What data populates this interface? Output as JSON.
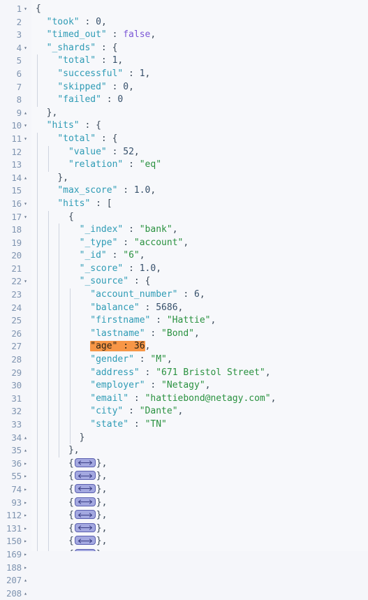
{
  "editor": {
    "name": "json-response-viewer",
    "language": "json",
    "colors": {
      "background": "#f7f8fb",
      "gutter_background": "#f5f6fa",
      "line_number": "#7f94b0",
      "key": "#2e9bb5",
      "string": "#29913f",
      "number": "#36506b",
      "boolean": "#7b57d6",
      "punctuation": "#3b4a5a",
      "search_highlight": "#f79646",
      "indent_guide": "#cfd4df",
      "fold_widget_fill": "#a3a8e0",
      "fold_widget_border": "#5a5fb0"
    },
    "search_highlight_text": "\"age\" : 36",
    "fold_icons": {
      "expanded": "chevron-down-icon",
      "collapsed": "chevron-right-icon",
      "end": "chevron-up-icon",
      "none": "no-fold-icon"
    },
    "collapsed_placeholder_icon": "horizontal-double-arrow-icon",
    "lines": [
      {
        "no": "1",
        "fold": "expanded",
        "guides": 0,
        "tokens": [
          {
            "t": "{",
            "c": "p"
          }
        ]
      },
      {
        "no": "2",
        "fold": "none",
        "guides": 0,
        "tokens": [
          {
            "t": "  ",
            "c": "p"
          },
          {
            "t": "\"took\"",
            "c": "k"
          },
          {
            "t": " : ",
            "c": "p"
          },
          {
            "t": "0",
            "c": "n"
          },
          {
            "t": ",",
            "c": "p"
          }
        ]
      },
      {
        "no": "3",
        "fold": "none",
        "guides": 0,
        "tokens": [
          {
            "t": "  ",
            "c": "p"
          },
          {
            "t": "\"timed_out\"",
            "c": "k"
          },
          {
            "t": " : ",
            "c": "p"
          },
          {
            "t": "false",
            "c": "b"
          },
          {
            "t": ",",
            "c": "p"
          }
        ]
      },
      {
        "no": "4",
        "fold": "expanded",
        "guides": 0,
        "tokens": [
          {
            "t": "  ",
            "c": "p"
          },
          {
            "t": "\"_shards\"",
            "c": "k"
          },
          {
            "t": " : ",
            "c": "p"
          },
          {
            "t": "{",
            "c": "p"
          }
        ]
      },
      {
        "no": "5",
        "fold": "none",
        "guides": 1,
        "tokens": [
          {
            "t": "    ",
            "c": "p"
          },
          {
            "t": "\"total\"",
            "c": "k"
          },
          {
            "t": " : ",
            "c": "p"
          },
          {
            "t": "1",
            "c": "n"
          },
          {
            "t": ",",
            "c": "p"
          }
        ]
      },
      {
        "no": "6",
        "fold": "none",
        "guides": 1,
        "tokens": [
          {
            "t": "    ",
            "c": "p"
          },
          {
            "t": "\"successful\"",
            "c": "k"
          },
          {
            "t": " : ",
            "c": "p"
          },
          {
            "t": "1",
            "c": "n"
          },
          {
            "t": ",",
            "c": "p"
          }
        ]
      },
      {
        "no": "7",
        "fold": "none",
        "guides": 1,
        "tokens": [
          {
            "t": "    ",
            "c": "p"
          },
          {
            "t": "\"skipped\"",
            "c": "k"
          },
          {
            "t": " : ",
            "c": "p"
          },
          {
            "t": "0",
            "c": "n"
          },
          {
            "t": ",",
            "c": "p"
          }
        ]
      },
      {
        "no": "8",
        "fold": "none",
        "guides": 1,
        "tokens": [
          {
            "t": "    ",
            "c": "p"
          },
          {
            "t": "\"failed\"",
            "c": "k"
          },
          {
            "t": " : ",
            "c": "p"
          },
          {
            "t": "0",
            "c": "n"
          }
        ]
      },
      {
        "no": "9",
        "fold": "end",
        "guides": 0,
        "tokens": [
          {
            "t": "  ",
            "c": "p"
          },
          {
            "t": "},",
            "c": "p"
          }
        ]
      },
      {
        "no": "10",
        "fold": "expanded",
        "guides": 0,
        "tokens": [
          {
            "t": "  ",
            "c": "p"
          },
          {
            "t": "\"hits\"",
            "c": "k"
          },
          {
            "t": " : ",
            "c": "p"
          },
          {
            "t": "{",
            "c": "p"
          }
        ]
      },
      {
        "no": "11",
        "fold": "expanded",
        "guides": 1,
        "tokens": [
          {
            "t": "    ",
            "c": "p"
          },
          {
            "t": "\"total\"",
            "c": "k"
          },
          {
            "t": " : ",
            "c": "p"
          },
          {
            "t": "{",
            "c": "p"
          }
        ]
      },
      {
        "no": "12",
        "fold": "none",
        "guides": 2,
        "tokens": [
          {
            "t": "      ",
            "c": "p"
          },
          {
            "t": "\"value\"",
            "c": "k"
          },
          {
            "t": " : ",
            "c": "p"
          },
          {
            "t": "52",
            "c": "n"
          },
          {
            "t": ",",
            "c": "p"
          }
        ]
      },
      {
        "no": "13",
        "fold": "none",
        "guides": 2,
        "tokens": [
          {
            "t": "      ",
            "c": "p"
          },
          {
            "t": "\"relation\"",
            "c": "k"
          },
          {
            "t": " : ",
            "c": "p"
          },
          {
            "t": "\"eq\"",
            "c": "s"
          }
        ]
      },
      {
        "no": "14",
        "fold": "end",
        "guides": 1,
        "tokens": [
          {
            "t": "    ",
            "c": "p"
          },
          {
            "t": "},",
            "c": "p"
          }
        ]
      },
      {
        "no": "15",
        "fold": "none",
        "guides": 1,
        "tokens": [
          {
            "t": "    ",
            "c": "p"
          },
          {
            "t": "\"max_score\"",
            "c": "k"
          },
          {
            "t": " : ",
            "c": "p"
          },
          {
            "t": "1.0",
            "c": "n"
          },
          {
            "t": ",",
            "c": "p"
          }
        ]
      },
      {
        "no": "16",
        "fold": "expanded",
        "guides": 1,
        "tokens": [
          {
            "t": "    ",
            "c": "p"
          },
          {
            "t": "\"hits\"",
            "c": "k"
          },
          {
            "t": " : ",
            "c": "p"
          },
          {
            "t": "[",
            "c": "p"
          }
        ]
      },
      {
        "no": "17",
        "fold": "expanded",
        "guides": 2,
        "tokens": [
          {
            "t": "      ",
            "c": "p"
          },
          {
            "t": "{",
            "c": "p"
          }
        ]
      },
      {
        "no": "18",
        "fold": "none",
        "guides": 3,
        "tokens": [
          {
            "t": "        ",
            "c": "p"
          },
          {
            "t": "\"_index\"",
            "c": "k"
          },
          {
            "t": " : ",
            "c": "p"
          },
          {
            "t": "\"bank\"",
            "c": "s"
          },
          {
            "t": ",",
            "c": "p"
          }
        ]
      },
      {
        "no": "19",
        "fold": "none",
        "guides": 3,
        "tokens": [
          {
            "t": "        ",
            "c": "p"
          },
          {
            "t": "\"_type\"",
            "c": "k"
          },
          {
            "t": " : ",
            "c": "p"
          },
          {
            "t": "\"account\"",
            "c": "s"
          },
          {
            "t": ",",
            "c": "p"
          }
        ]
      },
      {
        "no": "20",
        "fold": "none",
        "guides": 3,
        "tokens": [
          {
            "t": "        ",
            "c": "p"
          },
          {
            "t": "\"_id\"",
            "c": "k"
          },
          {
            "t": " : ",
            "c": "p"
          },
          {
            "t": "\"6\"",
            "c": "s"
          },
          {
            "t": ",",
            "c": "p"
          }
        ]
      },
      {
        "no": "21",
        "fold": "none",
        "guides": 3,
        "tokens": [
          {
            "t": "        ",
            "c": "p"
          },
          {
            "t": "\"_score\"",
            "c": "k"
          },
          {
            "t": " : ",
            "c": "p"
          },
          {
            "t": "1.0",
            "c": "n"
          },
          {
            "t": ",",
            "c": "p"
          }
        ]
      },
      {
        "no": "22",
        "fold": "expanded",
        "guides": 3,
        "tokens": [
          {
            "t": "        ",
            "c": "p"
          },
          {
            "t": "\"_source\"",
            "c": "k"
          },
          {
            "t": " : ",
            "c": "p"
          },
          {
            "t": "{",
            "c": "p"
          }
        ]
      },
      {
        "no": "23",
        "fold": "none",
        "guides": 4,
        "tokens": [
          {
            "t": "          ",
            "c": "p"
          },
          {
            "t": "\"account_number\"",
            "c": "k"
          },
          {
            "t": " : ",
            "c": "p"
          },
          {
            "t": "6",
            "c": "n"
          },
          {
            "t": ",",
            "c": "p"
          }
        ]
      },
      {
        "no": "24",
        "fold": "none",
        "guides": 4,
        "tokens": [
          {
            "t": "          ",
            "c": "p"
          },
          {
            "t": "\"balance\"",
            "c": "k"
          },
          {
            "t": " : ",
            "c": "p"
          },
          {
            "t": "5686",
            "c": "n"
          },
          {
            "t": ",",
            "c": "p"
          }
        ]
      },
      {
        "no": "25",
        "fold": "none",
        "guides": 4,
        "tokens": [
          {
            "t": "          ",
            "c": "p"
          },
          {
            "t": "\"firstname\"",
            "c": "k"
          },
          {
            "t": " : ",
            "c": "p"
          },
          {
            "t": "\"Hattie\"",
            "c": "s"
          },
          {
            "t": ",",
            "c": "p"
          }
        ]
      },
      {
        "no": "26",
        "fold": "none",
        "guides": 4,
        "tokens": [
          {
            "t": "          ",
            "c": "p"
          },
          {
            "t": "\"lastname\"",
            "c": "k"
          },
          {
            "t": " : ",
            "c": "p"
          },
          {
            "t": "\"Bond\"",
            "c": "s"
          },
          {
            "t": ",",
            "c": "p"
          }
        ]
      },
      {
        "no": "27",
        "fold": "none",
        "guides": 4,
        "highlight": true,
        "tokens": [
          {
            "t": "          ",
            "c": "p"
          },
          {
            "t": "\"age\"",
            "c": "k",
            "h": true
          },
          {
            "t": " : ",
            "c": "p",
            "h": true
          },
          {
            "t": "36",
            "c": "n",
            "h": true
          },
          {
            "t": ",",
            "c": "p"
          }
        ]
      },
      {
        "no": "28",
        "fold": "none",
        "guides": 4,
        "tokens": [
          {
            "t": "          ",
            "c": "p"
          },
          {
            "t": "\"gender\"",
            "c": "k"
          },
          {
            "t": " : ",
            "c": "p"
          },
          {
            "t": "\"M\"",
            "c": "s"
          },
          {
            "t": ",",
            "c": "p"
          }
        ]
      },
      {
        "no": "29",
        "fold": "none",
        "guides": 4,
        "tokens": [
          {
            "t": "          ",
            "c": "p"
          },
          {
            "t": "\"address\"",
            "c": "k"
          },
          {
            "t": " : ",
            "c": "p"
          },
          {
            "t": "\"671 Bristol Street\"",
            "c": "s"
          },
          {
            "t": ",",
            "c": "p"
          }
        ]
      },
      {
        "no": "30",
        "fold": "none",
        "guides": 4,
        "tokens": [
          {
            "t": "          ",
            "c": "p"
          },
          {
            "t": "\"employer\"",
            "c": "k"
          },
          {
            "t": " : ",
            "c": "p"
          },
          {
            "t": "\"Netagy\"",
            "c": "s"
          },
          {
            "t": ",",
            "c": "p"
          }
        ]
      },
      {
        "no": "31",
        "fold": "none",
        "guides": 4,
        "tokens": [
          {
            "t": "          ",
            "c": "p"
          },
          {
            "t": "\"email\"",
            "c": "k"
          },
          {
            "t": " : ",
            "c": "p"
          },
          {
            "t": "\"hattiebond@netagy.com\"",
            "c": "s"
          },
          {
            "t": ",",
            "c": "p"
          }
        ]
      },
      {
        "no": "32",
        "fold": "none",
        "guides": 4,
        "tokens": [
          {
            "t": "          ",
            "c": "p"
          },
          {
            "t": "\"city\"",
            "c": "k"
          },
          {
            "t": " : ",
            "c": "p"
          },
          {
            "t": "\"Dante\"",
            "c": "s"
          },
          {
            "t": ",",
            "c": "p"
          }
        ]
      },
      {
        "no": "33",
        "fold": "none",
        "guides": 4,
        "tokens": [
          {
            "t": "          ",
            "c": "p"
          },
          {
            "t": "\"state\"",
            "c": "k"
          },
          {
            "t": " : ",
            "c": "p"
          },
          {
            "t": "\"TN\"",
            "c": "s"
          }
        ]
      },
      {
        "no": "34",
        "fold": "end",
        "guides": 4,
        "tokens": [
          {
            "t": "        ",
            "c": "p"
          },
          {
            "t": "}",
            "c": "p"
          }
        ]
      },
      {
        "no": "35",
        "fold": "end",
        "guides": 3,
        "tokens": [
          {
            "t": "      ",
            "c": "p"
          },
          {
            "t": "},",
            "c": "p"
          }
        ]
      },
      {
        "no": "36",
        "fold": "collapsed",
        "guides": 2,
        "collapsed": true,
        "tokens": [
          {
            "t": "      ",
            "c": "p"
          },
          {
            "t": "{",
            "c": "p"
          },
          {
            "t": "FOLD",
            "c": "widget"
          },
          {
            "t": "},",
            "c": "p"
          }
        ]
      },
      {
        "no": "55",
        "fold": "collapsed",
        "guides": 2,
        "collapsed": true,
        "tokens": [
          {
            "t": "      ",
            "c": "p"
          },
          {
            "t": "{",
            "c": "p"
          },
          {
            "t": "FOLD",
            "c": "widget"
          },
          {
            "t": "},",
            "c": "p"
          }
        ]
      },
      {
        "no": "74",
        "fold": "collapsed",
        "guides": 2,
        "collapsed": true,
        "tokens": [
          {
            "t": "      ",
            "c": "p"
          },
          {
            "t": "{",
            "c": "p"
          },
          {
            "t": "FOLD",
            "c": "widget"
          },
          {
            "t": "},",
            "c": "p"
          }
        ]
      },
      {
        "no": "93",
        "fold": "collapsed",
        "guides": 2,
        "collapsed": true,
        "tokens": [
          {
            "t": "      ",
            "c": "p"
          },
          {
            "t": "{",
            "c": "p"
          },
          {
            "t": "FOLD",
            "c": "widget"
          },
          {
            "t": "},",
            "c": "p"
          }
        ]
      },
      {
        "no": "112",
        "fold": "collapsed",
        "guides": 2,
        "collapsed": true,
        "tokens": [
          {
            "t": "      ",
            "c": "p"
          },
          {
            "t": "{",
            "c": "p"
          },
          {
            "t": "FOLD",
            "c": "widget"
          },
          {
            "t": "},",
            "c": "p"
          }
        ]
      },
      {
        "no": "131",
        "fold": "collapsed",
        "guides": 2,
        "collapsed": true,
        "tokens": [
          {
            "t": "      ",
            "c": "p"
          },
          {
            "t": "{",
            "c": "p"
          },
          {
            "t": "FOLD",
            "c": "widget"
          },
          {
            "t": "},",
            "c": "p"
          }
        ]
      },
      {
        "no": "150",
        "fold": "collapsed",
        "guides": 2,
        "collapsed": true,
        "tokens": [
          {
            "t": "      ",
            "c": "p"
          },
          {
            "t": "{",
            "c": "p"
          },
          {
            "t": "FOLD",
            "c": "widget"
          },
          {
            "t": "},",
            "c": "p"
          }
        ]
      },
      {
        "no": "169",
        "fold": "collapsed",
        "guides": 2,
        "collapsed": true,
        "tokens": [
          {
            "t": "      ",
            "c": "p"
          },
          {
            "t": "{",
            "c": "p"
          },
          {
            "t": "FOLD",
            "c": "widget"
          },
          {
            "t": "},",
            "c": "p"
          }
        ]
      },
      {
        "no": "188",
        "fold": "collapsed",
        "guides": 2,
        "collapsed": true,
        "tokens": [
          {
            "t": "      ",
            "c": "p"
          },
          {
            "t": "{",
            "c": "p"
          },
          {
            "t": "FOLD",
            "c": "widget"
          },
          {
            "t": "}",
            "c": "p"
          }
        ]
      },
      {
        "no": "207",
        "fold": "end",
        "guides": 1,
        "tokens": [
          {
            "t": "    ",
            "c": "p"
          },
          {
            "t": "]",
            "c": "p"
          }
        ]
      },
      {
        "no": "208",
        "fold": "end",
        "guides": 0,
        "tokens": [
          {
            "t": "  ",
            "c": "p"
          },
          {
            "t": "}",
            "c": "p"
          }
        ]
      }
    ]
  }
}
